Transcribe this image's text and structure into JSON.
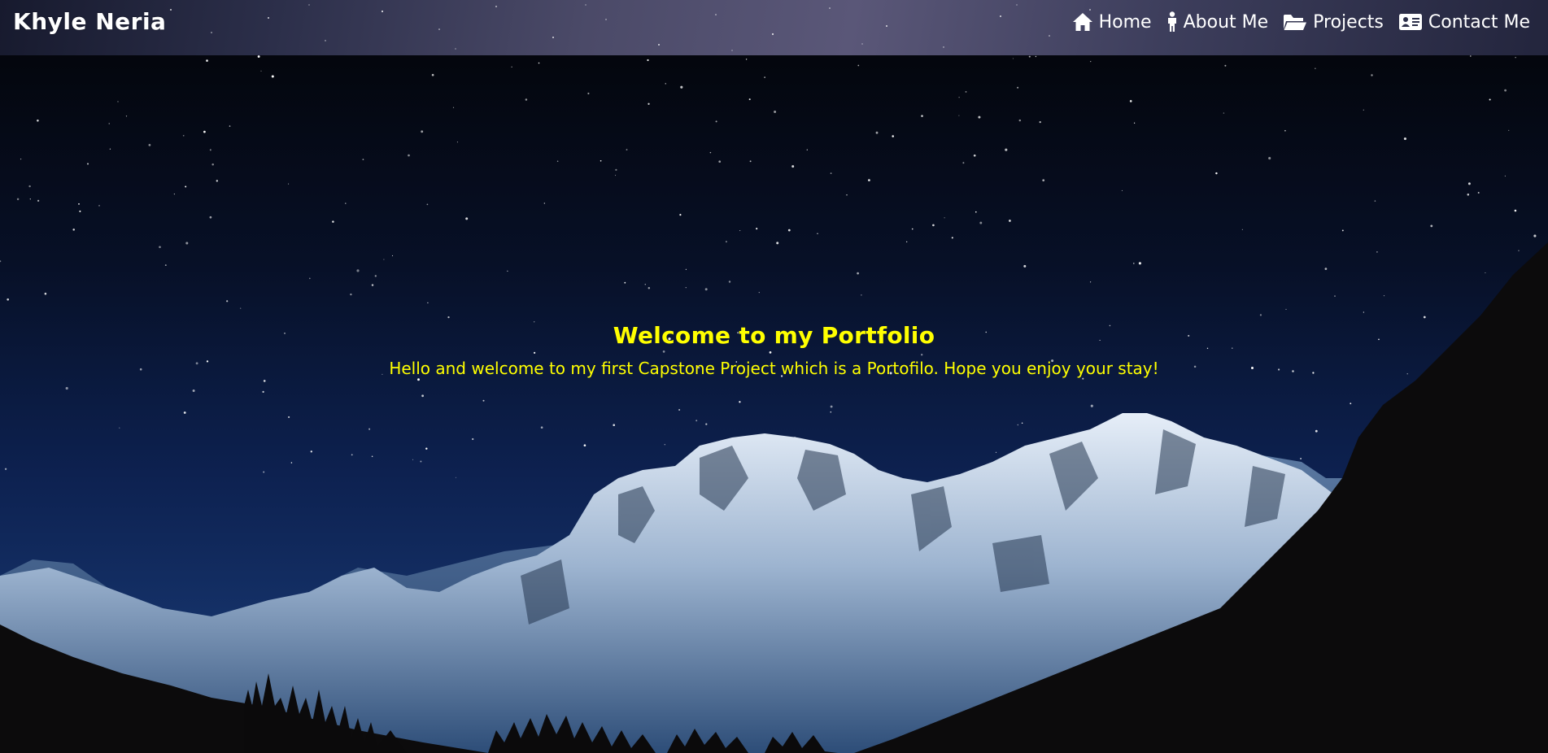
{
  "brand": {
    "name": "Khyle Neria"
  },
  "nav": {
    "items": [
      {
        "label": "Home",
        "icon": "home-icon"
      },
      {
        "label": "About Me",
        "icon": "person-icon"
      },
      {
        "label": "Projects",
        "icon": "folder-open-icon"
      },
      {
        "label": "Contact Me",
        "icon": "address-card-icon"
      }
    ]
  },
  "hero": {
    "title": "Welcome to my Portfolio",
    "subtitle": "Hello and welcome to my first Capstone Project which is a Portofilo. Hope you enjoy your stay!"
  },
  "colors": {
    "accent": "#ffff00",
    "nav_text": "#ffffff",
    "sky_top": "#04060d",
    "sky_bottom": "#143066",
    "foreground": "#0b0a0b"
  }
}
